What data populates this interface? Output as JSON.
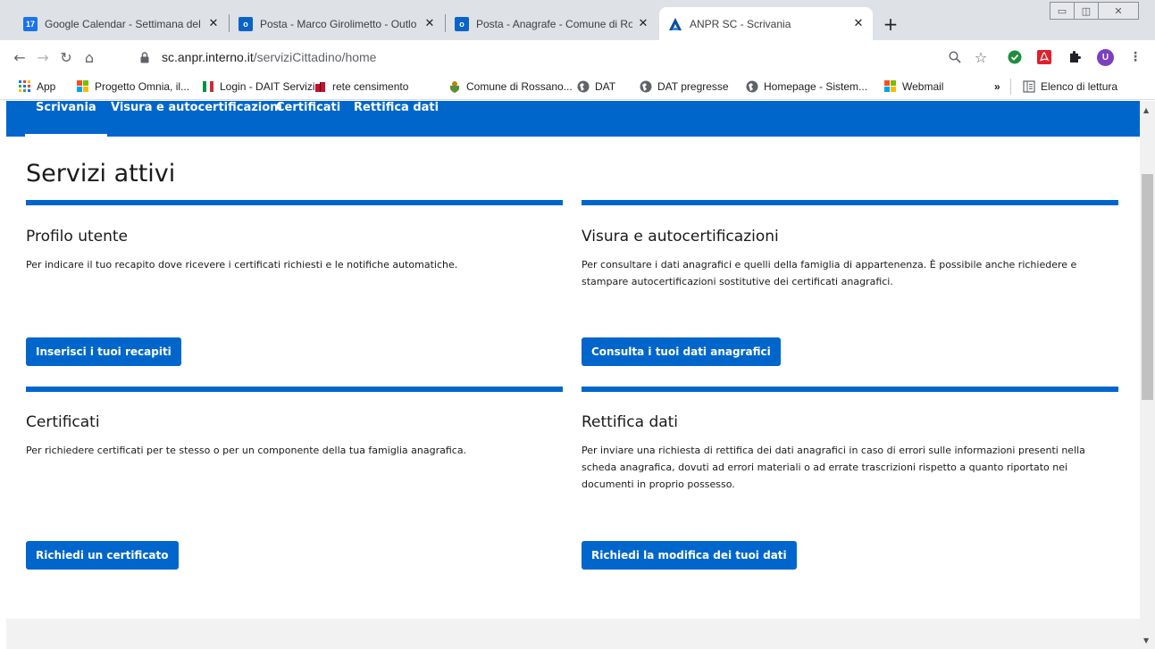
{
  "browser": {
    "tabs": [
      {
        "title": "Google Calendar - Settimana del",
        "icon": "calendar-icon",
        "icon_text": "17",
        "icon_color": "#1a73e8"
      },
      {
        "title": "Posta - Marco Girolimetto - Outlo",
        "icon": "outlook-icon",
        "icon_text": "o",
        "icon_color": "#0a64c8"
      },
      {
        "title": "Posta - Anagrafe - Comune di Ro",
        "icon": "outlook-icon",
        "icon_text": "o",
        "icon_color": "#0a64c8"
      },
      {
        "title": "ANPR SC - Scrivania",
        "icon": "anpr-logo-icon",
        "active": true
      }
    ],
    "address": {
      "domain": "sc.anpr.interno.it",
      "path": "/serviziCittadino/home"
    },
    "avatar_letter": "U",
    "bookmarks": [
      {
        "label": "App",
        "icon": "apps-grid-icon"
      },
      {
        "label": "Progetto Omnia, il...",
        "icon": "windows-logo-icon"
      },
      {
        "label": "Login - DAIT Servizi",
        "icon": "italy-flag-icon"
      },
      {
        "label": "rete censimento",
        "icon": "istat-icon"
      },
      {
        "label": "Comune di Rossano...",
        "icon": "coat-of-arms-icon"
      },
      {
        "label": "DAT",
        "icon": "globe-icon"
      },
      {
        "label": "DAT pregresse",
        "icon": "globe-icon"
      },
      {
        "label": "Homepage - Sistem...",
        "icon": "globe-icon"
      },
      {
        "label": "Webmail",
        "icon": "microsoft-logo-icon"
      }
    ],
    "bookmarks_overflow": "»",
    "reading_list": "Elenco di lettura"
  },
  "site": {
    "nav": [
      {
        "label": "Scrivania",
        "active": true
      },
      {
        "label": "Visura e autocertificazioni"
      },
      {
        "label": "Certificati"
      },
      {
        "label": "Rettifica dati"
      }
    ],
    "page_title": "Servizi attivi",
    "cards": [
      {
        "title": "Profilo utente",
        "description": "Per indicare il tuo recapito dove ricevere i certificati richiesti e le notifiche automatiche.",
        "button": "Inserisci i tuoi recapiti"
      },
      {
        "title": "Visura e autocertificazioni",
        "description": "Per consultare i dati anagrafici e quelli della famiglia di appartenenza. È possibile anche richiedere e stampare autocertificazioni sostitutive dei certificati anagrafici.",
        "button": "Consulta i tuoi dati anagrafici"
      },
      {
        "title": "Certificati",
        "description": "Per richiedere certificati per te stesso o per un componente della tua famiglia anagrafica.",
        "button": "Richiedi un certificato"
      },
      {
        "title": "Rettifica dati",
        "description": "Per inviare una richiesta di rettifica dei dati anagrafici in caso di errori sulle informazioni presenti nella scheda anagrafica, dovuti ad errori materiali o ad errate trascrizioni rispetto a quanto riportato nei documenti in proprio possesso.",
        "button": "Richiedi la modifica dei tuoi dati"
      }
    ]
  },
  "colors": {
    "brand_blue": "#0066cc",
    "tabstrip": "#dee1e6"
  }
}
